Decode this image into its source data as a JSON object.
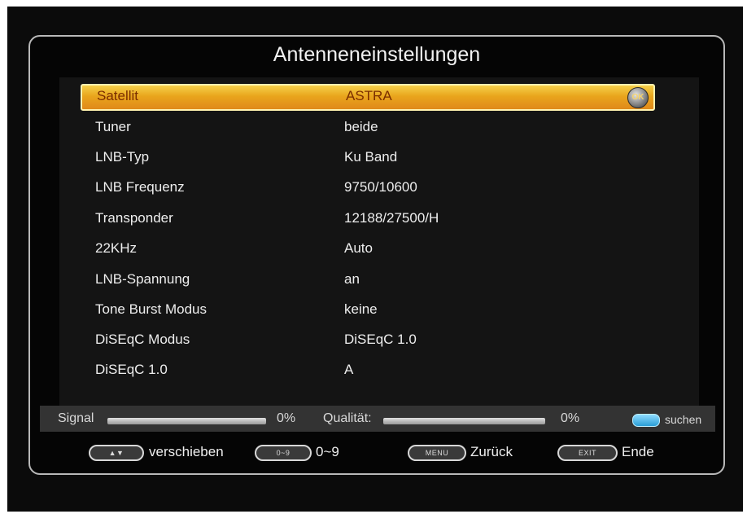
{
  "title": "Antenneneinstellungen",
  "settings": [
    {
      "label": "Satellit",
      "value": "ASTRA",
      "selected": true
    },
    {
      "label": "Tuner",
      "value": "beide"
    },
    {
      "label": "LNB-Typ",
      "value": "Ku Band"
    },
    {
      "label": "LNB Frequenz",
      "value": "9750/10600"
    },
    {
      "label": "Transponder",
      "value": "12188/27500/H"
    },
    {
      "label": "22KHz",
      "value": "Auto"
    },
    {
      "label": "LNB-Spannung",
      "value": "an"
    },
    {
      "label": "Tone Burst Modus",
      "value": "keine"
    },
    {
      "label": "DiSEqC Modus",
      "value": "DiSEqC 1.0"
    },
    {
      "label": "DiSEqC 1.0",
      "value": "A"
    }
  ],
  "ok_key": "OK",
  "status": {
    "signal_label": "Signal",
    "signal_value": "0%",
    "signal_fraction": 0,
    "quality_label": "Qualität:",
    "quality_value": "0%",
    "quality_fraction": 0,
    "blue_label": "suchen"
  },
  "footer": {
    "updown_key": "▲▼",
    "updown_label": "verschieben",
    "num_key": "0~9",
    "num_label": "0~9",
    "menu_key": "MENU",
    "menu_label": "Zurück",
    "exit_key": "EXIT",
    "exit_label": "Ende"
  },
  "colors": {
    "highlight": "#e9a51c",
    "blue_button": "#2a9ed6"
  }
}
